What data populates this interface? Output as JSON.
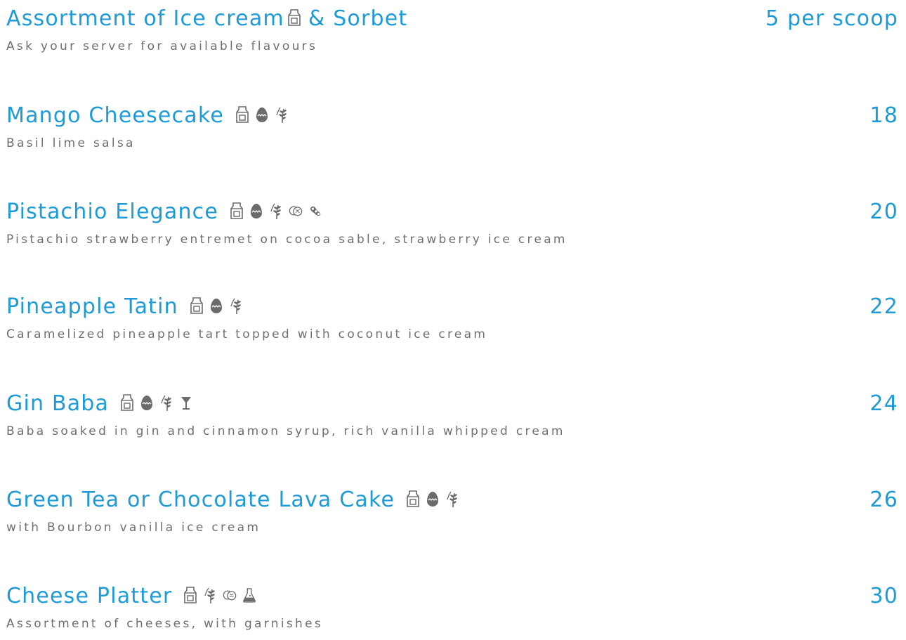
{
  "menu": {
    "items": [
      {
        "name": "Assortment of Ice cream",
        "name_suffix": "& Sorbet",
        "price": "5 per scoop",
        "description": "Ask your server for available flavours",
        "icons": [
          "milk-icon"
        ]
      },
      {
        "name": "Mango Cheesecake",
        "price": "18",
        "description": "Basil lime salsa",
        "icons": [
          "milk-icon",
          "egg-icon",
          "wheat-icon"
        ]
      },
      {
        "name": "Pistachio Elegance",
        "price": "20",
        "description": "Pistachio strawberry entremet on cocoa sable, strawberry ice cream",
        "icons": [
          "milk-icon",
          "egg-icon",
          "wheat-icon",
          "nuts-icon",
          "soy-icon"
        ]
      },
      {
        "name": "Pineapple Tatin",
        "price": "22",
        "description": "Caramelized pineapple tart topped with coconut ice cream",
        "icons": [
          "milk-icon",
          "egg-icon",
          "wheat-icon"
        ]
      },
      {
        "name": "Gin Baba",
        "price": "24",
        "description": "Baba soaked in gin and cinnamon syrup, rich vanilla whipped cream",
        "icons": [
          "milk-icon",
          "egg-icon",
          "wheat-icon",
          "alcohol-icon"
        ]
      },
      {
        "name": "Green Tea or Chocolate Lava Cake",
        "price": "26",
        "description": "with Bourbon vanilla ice cream",
        "icons": [
          "milk-icon",
          "egg-icon",
          "wheat-icon"
        ]
      },
      {
        "name": "Cheese Platter",
        "price": "30",
        "description": "Assortment of cheeses, with garnishes",
        "icons": [
          "milk-icon",
          "wheat-icon",
          "nuts-icon",
          "flask-icon"
        ]
      }
    ]
  },
  "colors": {
    "title": "#1d9bd8",
    "price": "#1d9bd8",
    "description": "#6f6f6f",
    "icon": "#6b6b6b",
    "background": "#ffffff"
  }
}
